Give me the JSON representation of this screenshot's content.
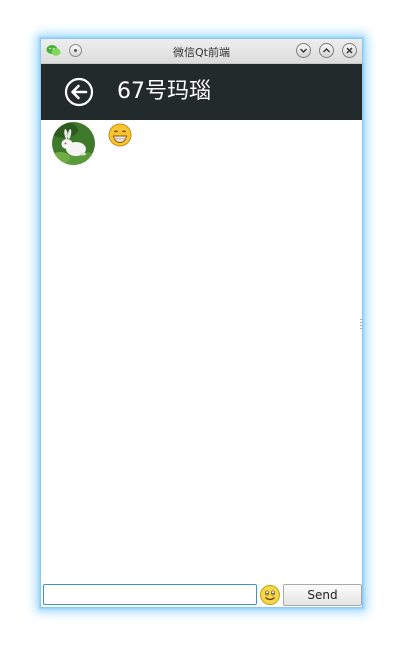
{
  "window": {
    "title": "微信Qt前端",
    "controls": [
      "minimize",
      "maximize",
      "close"
    ]
  },
  "header": {
    "contact_name": "67号玛瑙",
    "background_color": "#222a2c"
  },
  "conversation": {
    "messages": [
      {
        "sender": "contact",
        "avatar": "white-rabbit",
        "content": "grinning-emoji"
      }
    ]
  },
  "composer": {
    "input_value": "",
    "emoji_icon": "smiley-emoji",
    "send_label": "Send"
  },
  "colors": {
    "accent_glow": "#9fd8ff",
    "input_focus": "#3c97c9"
  }
}
